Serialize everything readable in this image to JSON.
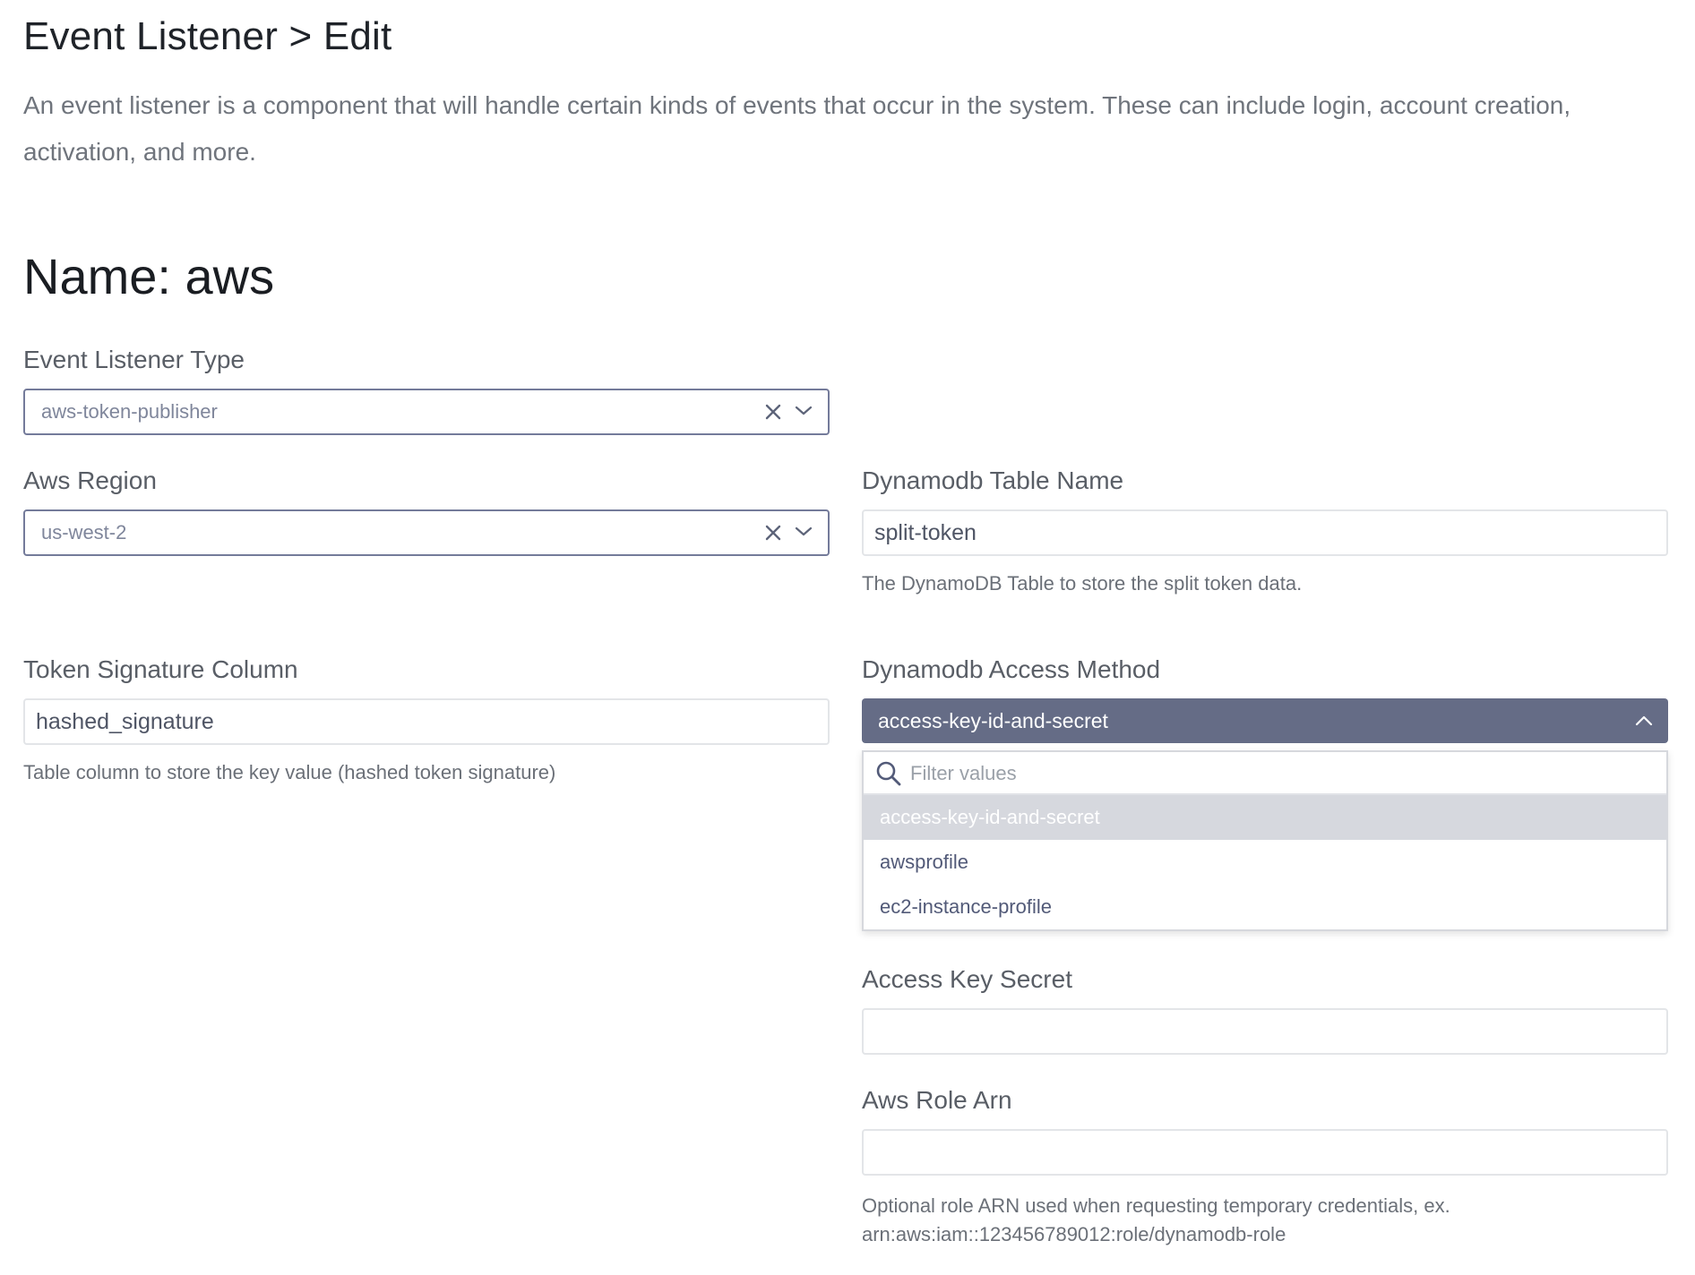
{
  "header": {
    "breadcrumb": "Event Listener > Edit",
    "description": "An event listener is a component that will handle certain kinds of events that occur in the system. These can include login, account creation, activation, and more."
  },
  "name_heading": "Name: aws",
  "fields": {
    "event_listener_type": {
      "label": "Event Listener Type",
      "value": "aws-token-publisher"
    },
    "aws_region": {
      "label": "Aws Region",
      "value": "us-west-2"
    },
    "dynamodb_table_name": {
      "label": "Dynamodb Table Name",
      "value": "split-token",
      "help": "The DynamoDB Table to store the split token data."
    },
    "token_signature_column": {
      "label": "Token Signature Column",
      "value": "hashed_signature",
      "help": "Table column to store the key value (hashed token signature)"
    },
    "dynamodb_access_method": {
      "label": "Dynamodb Access Method",
      "value": "access-key-id-and-secret",
      "filter_placeholder": "Filter values",
      "options": [
        "access-key-id-and-secret",
        "awsprofile",
        "ec2-instance-profile"
      ]
    },
    "access_key_secret": {
      "label": "Access Key Secret",
      "value": ""
    },
    "aws_role_arn": {
      "label": "Aws Role Arn",
      "value": "",
      "help_line1": "Optional role ARN used when requesting temporary credentials, ex.",
      "help_line2": "arn:aws:iam::123456789012:role/dynamodb-role"
    }
  },
  "icons": {
    "clear": "close-icon",
    "chevron_down": "chevron-down-icon",
    "chevron_up": "chevron-up-icon",
    "search": "search-icon"
  },
  "colors": {
    "accent_border": "#747b9a",
    "dark_select_bg": "#656c86",
    "selected_option_bg": "#d6d8de"
  }
}
